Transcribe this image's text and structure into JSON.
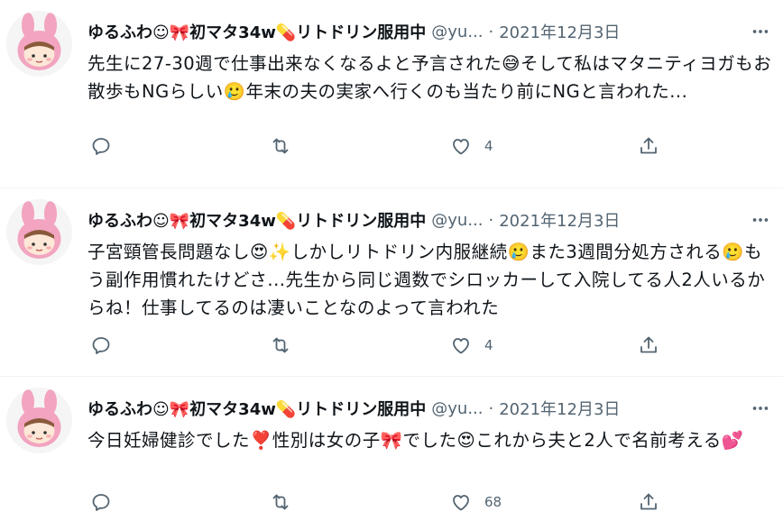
{
  "tweets": [
    {
      "name": "ゆるふわ☺🎀初マタ34w💊リトドリン服用中",
      "handle": "@yu...",
      "sep": "·",
      "date": "2021年12月3日",
      "text": "先生に27-30週で仕事出来なくなるよと予言された😅そして私はマタニティヨガもお散歩もNGらしい🥲年末の夫の実家へ行くのも当たり前にNGと言われた...",
      "reply_count": "",
      "retweet_count": "",
      "like_count": "4",
      "share_count": ""
    },
    {
      "name": "ゆるふわ☺🎀初マタ34w💊リトドリン服用中",
      "handle": "@yu...",
      "sep": "·",
      "date": "2021年12月3日",
      "text": "子宮頸管長問題なし😍✨しかしリトドリン内服継続🥲また3週間分処方される🥲もう副作用慣れたけどさ...先生から同じ週数でシロッカーして入院してる人2人いるからね！仕事してるのは凄いことなのよって言われた",
      "reply_count": "",
      "retweet_count": "",
      "like_count": "4",
      "share_count": ""
    },
    {
      "name": "ゆるふわ☺🎀初マタ34w💊リトドリン服用中",
      "handle": "@yu...",
      "sep": "·",
      "date": "2021年12月3日",
      "text": "今日妊婦健診でした❣️性別は女の子🎀でした😍これから夫と2人で名前考える💕",
      "reply_count": "",
      "retweet_count": "",
      "like_count": "68",
      "share_count": ""
    }
  ],
  "icons": {
    "reply": "reply-icon",
    "retweet": "retweet-icon",
    "like": "heart-icon",
    "share": "share-icon",
    "more": "more-icon",
    "avatar": "bunny-avatar"
  },
  "colors": {
    "text": "#0f1419",
    "secondary": "#536471",
    "divider": "#eff3f4",
    "avatar_pink": "#f2a4c0"
  }
}
